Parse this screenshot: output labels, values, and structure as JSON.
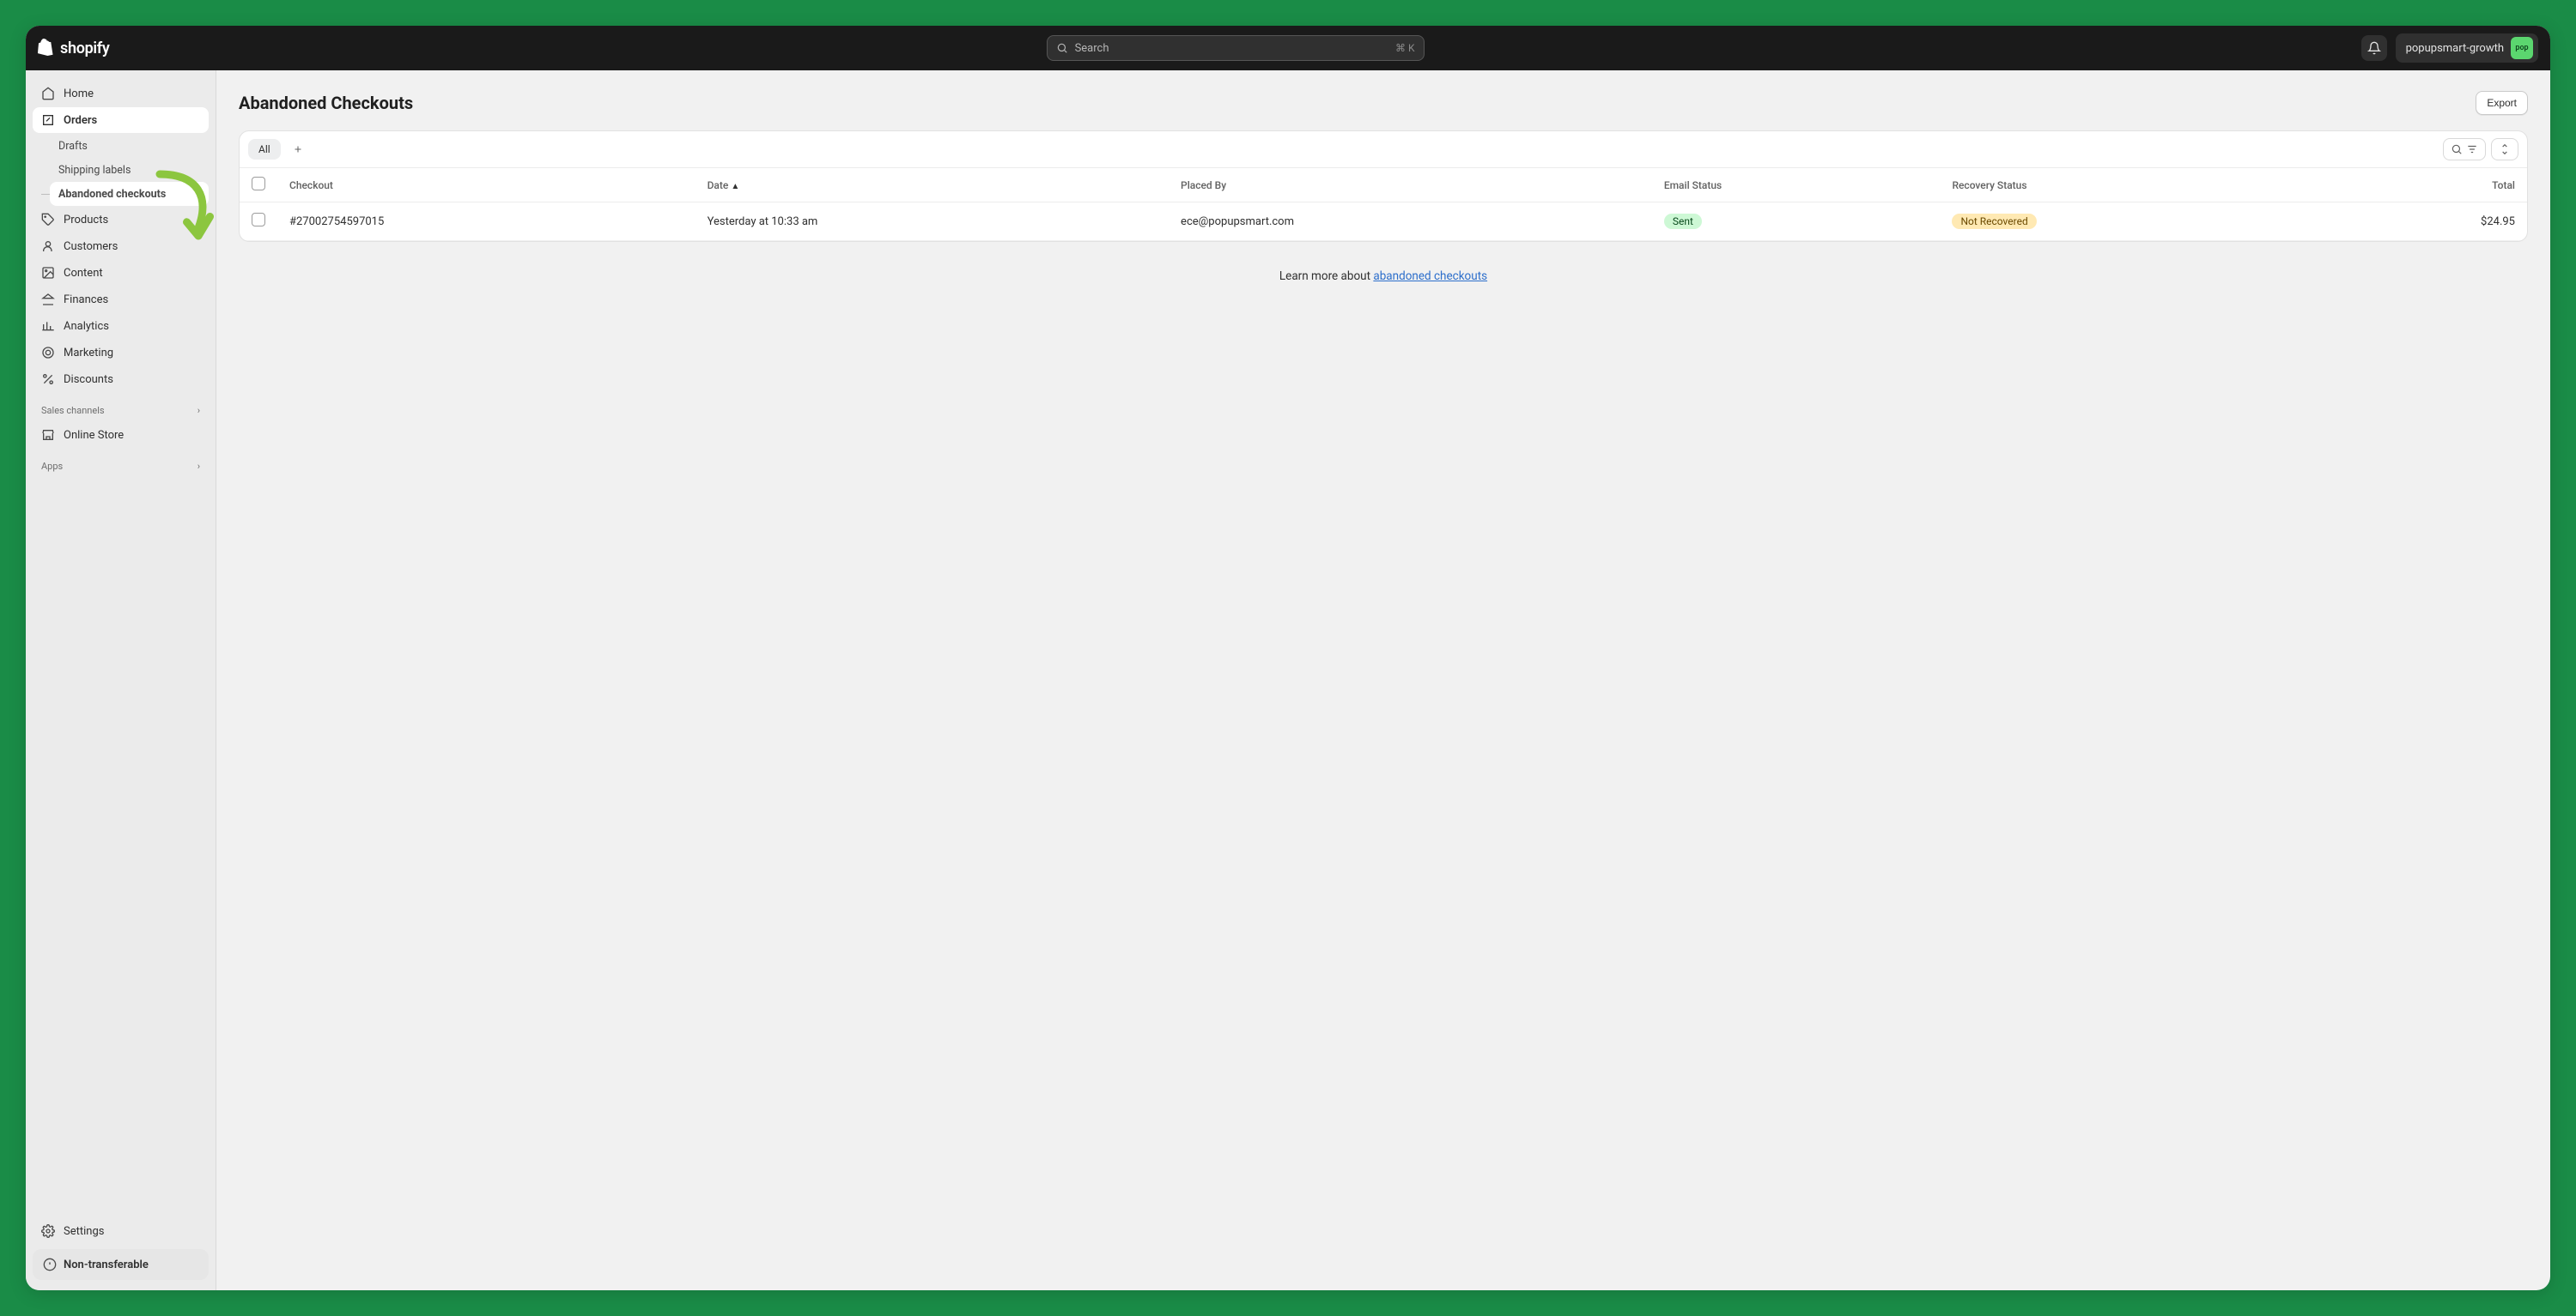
{
  "brand": "shopify",
  "search": {
    "placeholder": "Search",
    "shortcut": "⌘ K"
  },
  "store": {
    "name": "popupsmart-growth",
    "avatar_abbr": "pop"
  },
  "sidebar": {
    "items": [
      {
        "label": "Home"
      },
      {
        "label": "Orders"
      },
      {
        "label": "Products"
      },
      {
        "label": "Customers"
      },
      {
        "label": "Content"
      },
      {
        "label": "Finances"
      },
      {
        "label": "Analytics"
      },
      {
        "label": "Marketing"
      },
      {
        "label": "Discounts"
      }
    ],
    "orders_sub": [
      {
        "label": "Drafts"
      },
      {
        "label": "Shipping labels"
      },
      {
        "label": "Abandoned checkouts"
      }
    ],
    "sections": {
      "sales_channels": "Sales channels",
      "apps": "Apps"
    },
    "sales_channels": [
      {
        "label": "Online Store"
      }
    ],
    "settings_label": "Settings",
    "banner": "Non-transferable"
  },
  "page": {
    "title": "Abandoned Checkouts",
    "export_label": "Export"
  },
  "tabs": {
    "all": "All"
  },
  "table": {
    "headers": {
      "checkout": "Checkout",
      "date": "Date",
      "placed_by": "Placed By",
      "email_status": "Email Status",
      "recovery_status": "Recovery Status",
      "total": "Total"
    },
    "rows": [
      {
        "checkout": "#27002754597015",
        "date": "Yesterday at 10:33 am",
        "placed_by": "ece@popupsmart.com",
        "email_status": "Sent",
        "recovery_status": "Not Recovered",
        "total": "$24.95"
      }
    ]
  },
  "learn_more": {
    "prefix": "Learn more about ",
    "link": "abandoned checkouts"
  }
}
